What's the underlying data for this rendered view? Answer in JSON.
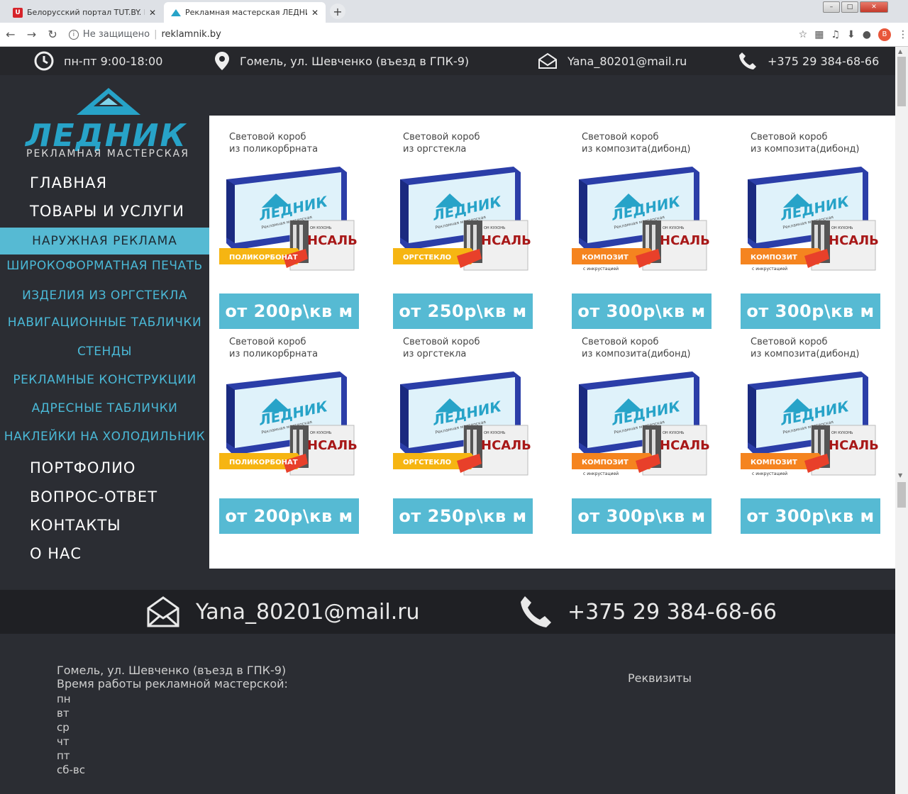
{
  "browser": {
    "tabs": [
      {
        "title": "Белорусский портал TUT.BY. Но",
        "active": false
      },
      {
        "title": "Рекламная мастерская ЛЕДНИК",
        "active": true
      }
    ],
    "address": {
      "security": "Не защищено",
      "url": "reklamnik.by"
    },
    "profile_initial": "B"
  },
  "topbar": {
    "hours": "пн-пт 9:00-18:00",
    "address": "Гомель, ул. Шевченко (въезд в ГПК-9)",
    "email": "Yana_80201@mail.ru",
    "phone": "+375 29 384-68-66"
  },
  "logo": {
    "word": "ЛЕДНИК",
    "subtitle": "РЕКЛАМНАЯ МАСТЕРСКАЯ"
  },
  "nav": [
    {
      "label": "ГЛАВНАЯ",
      "kind": "main"
    },
    {
      "label": "ТОВАРЫ И УСЛУГИ",
      "kind": "main"
    },
    {
      "label": "НАРУЖНАЯ  РЕКЛАМА",
      "kind": "active"
    },
    {
      "label": "ШИРОКОФОРМАТНАЯ ПЕЧАТЬ",
      "kind": "sub"
    },
    {
      "label": "ИЗДЕЛИЯ ИЗ ОРГСТЕКЛА",
      "kind": "sub"
    },
    {
      "label": "НАВИГАЦИОННЫЕ ТАБЛИЧКИ",
      "kind": "sub"
    },
    {
      "label": "СТЕНДЫ",
      "kind": "sub"
    },
    {
      "label": "РЕКЛАМНЫЕ КОНСТРУКЦИИ",
      "kind": "sub"
    },
    {
      "label": "АДРЕСНЫЕ ТАБЛИЧКИ",
      "kind": "sub"
    },
    {
      "label": "НАКЛЕЙКИ НА ХОЛОДИЛЬНИК",
      "kind": "sub"
    },
    {
      "label": "ПОРТФОЛИО",
      "kind": "main"
    },
    {
      "label": "ВОПРОС-ОТВЕТ",
      "kind": "main"
    },
    {
      "label": "КОНТАКТЫ",
      "kind": "main"
    },
    {
      "label": "О НАС",
      "kind": "main"
    }
  ],
  "products": [
    {
      "caption": [
        "Световой короб",
        "из поликорбрната"
      ],
      "material": "ПОЛИКОРБОНАТ",
      "note": "",
      "price": "от 200р\\кв м"
    },
    {
      "caption": [
        "Световой короб",
        "из оргстекла"
      ],
      "material": "ОРГСТЕКЛО",
      "note": "",
      "price": "от 250р\\кв м"
    },
    {
      "caption": [
        "Световой короб",
        "из композита(дибонд)"
      ],
      "material": "КОМПОЗИТ",
      "note": "с инкрустацией",
      "price": "от 300р\\кв м"
    },
    {
      "caption": [
        "Световой короб",
        "из композита(дибонд)"
      ],
      "material": "КОМПОЗИТ",
      "note": "с инкрустацией",
      "price": "от 300р\\кв м"
    },
    {
      "caption": [
        "Световой короб",
        "из поликорбрната"
      ],
      "material": "ПОЛИКОРБОНАТ",
      "note": "",
      "price": "от 200р\\кв м"
    },
    {
      "caption": [
        "Световой короб",
        "из оргстекла"
      ],
      "material": "ОРГСТЕКЛО",
      "note": "",
      "price": "от 250р\\кв м"
    },
    {
      "caption": [
        "Световой короб",
        "из композита(дибонд)"
      ],
      "material": "КОМПОЗИТ",
      "note": "с инкрустацией",
      "price": "от 300р\\кв м"
    },
    {
      "caption": [
        "Световой короб",
        "из композита(дибонд)"
      ],
      "material": "КОМПОЗИТ",
      "note": "с инкрустацией",
      "price": "от 300р\\кв м"
    }
  ],
  "product_image": {
    "brand": "ЛЕДНИК",
    "brand_sub": "Рекламная мастерская",
    "sign_small": "ОН КУХОНЬ",
    "sign_big": "НСАЛЬ"
  },
  "contact_band": {
    "email": "Yana_80201@mail.ru",
    "phone": "+375 29 384-68-66"
  },
  "footer": {
    "address": "Гомель, ул. Шевченко (въезд в ГПК-9)",
    "hours_title": "Время работы рекламной мастерской:",
    "days": [
      "пн",
      "вт",
      "ср",
      "чт",
      "пт",
      "сб-вс"
    ],
    "requisites": "Реквизиты"
  },
  "colors": {
    "accent": "#56bad3",
    "dark": "#2b2d33",
    "topbar": "#26272b",
    "logo_blue": "#27a3c8"
  }
}
